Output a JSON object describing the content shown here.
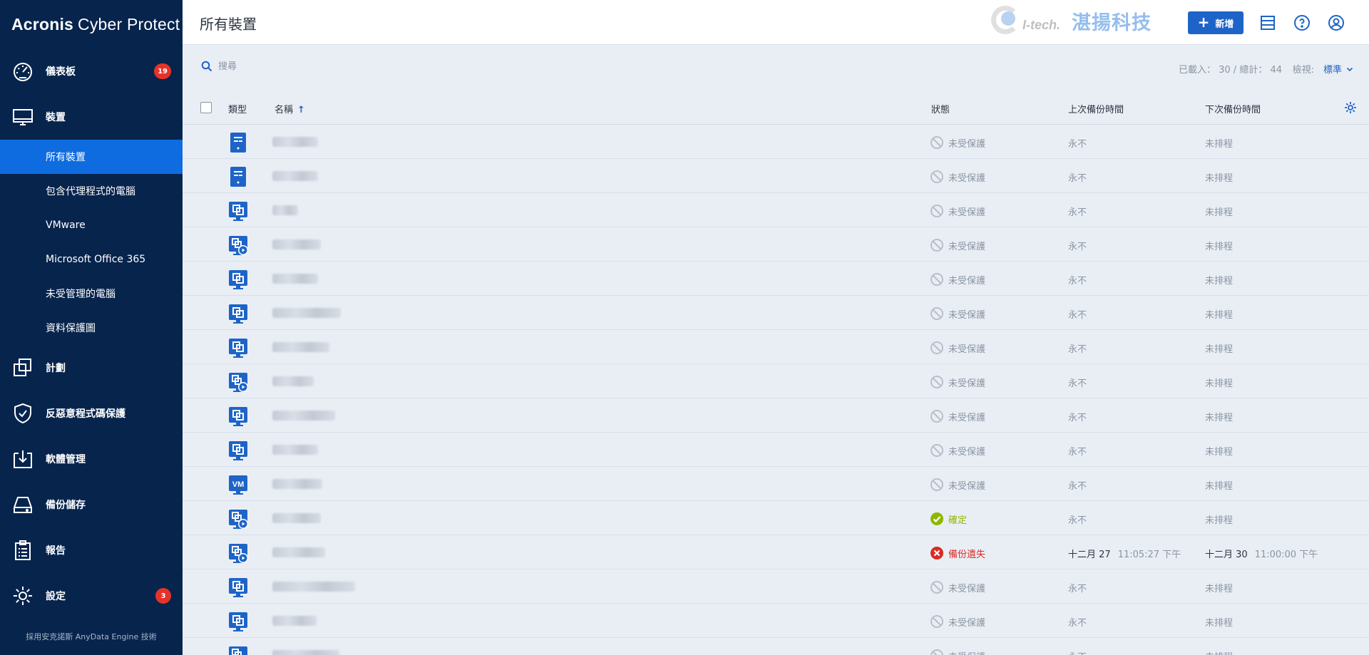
{
  "brand": {
    "part1": "Acronis",
    "part2": "Cyber Protect"
  },
  "sidebar": {
    "items": [
      {
        "label": "儀表板",
        "icon": "dashboard-icon",
        "badge": "19"
      },
      {
        "label": "裝置",
        "icon": "monitor-icon"
      },
      {
        "label": "計劃",
        "icon": "plans-icon"
      },
      {
        "label": "反惡意程式碼保護",
        "icon": "shield-icon"
      },
      {
        "label": "軟體管理",
        "icon": "software-management-icon"
      },
      {
        "label": "備份儲存",
        "icon": "storage-icon"
      },
      {
        "label": "報告",
        "icon": "report-icon"
      },
      {
        "label": "設定",
        "icon": "gear-icon",
        "badge": "3"
      }
    ],
    "sub_items": [
      {
        "label": "所有裝置",
        "active": true
      },
      {
        "label": "包含代理程式的電腦"
      },
      {
        "label": "VMware"
      },
      {
        "label": "Microsoft Office 365"
      },
      {
        "label": "未受管理的電腦"
      },
      {
        "label": "資料保護圖"
      }
    ],
    "footer": "採用安克諾斯 AnyData Engine 技術"
  },
  "header": {
    "title": "所有裝置",
    "watermark_en": "I-tech.",
    "watermark_zh": "湛揚科技",
    "add_label": "新增",
    "accent": "#1e64c8"
  },
  "toolbar": {
    "search_placeholder": "搜尋",
    "counts": "已載入： 30 / 總計： 44",
    "view_label": "檢視:",
    "view_value": "標準"
  },
  "table": {
    "columns": {
      "type": "類型",
      "name": "名稱",
      "status": "狀態",
      "last_backup": "上次備份時間",
      "next_backup": "下次備份時間"
    },
    "rows": [
      {
        "type": "server",
        "status": "未受保護",
        "state": "unprotected",
        "last": "永不",
        "next": "未排程"
      },
      {
        "type": "server",
        "status": "未受保護",
        "state": "unprotected",
        "last": "永不",
        "next": "未排程"
      },
      {
        "type": "workstation",
        "status": "未受保護",
        "state": "unprotected",
        "last": "永不",
        "next": "未排程"
      },
      {
        "type": "workstation-agent",
        "status": "未受保護",
        "state": "unprotected",
        "last": "永不",
        "next": "未排程"
      },
      {
        "type": "workstation",
        "status": "未受保護",
        "state": "unprotected",
        "last": "永不",
        "next": "未排程"
      },
      {
        "type": "workstation",
        "status": "未受保護",
        "state": "unprotected",
        "last": "永不",
        "next": "未排程"
      },
      {
        "type": "workstation",
        "status": "未受保護",
        "state": "unprotected",
        "last": "永不",
        "next": "未排程"
      },
      {
        "type": "workstation-agent",
        "status": "未受保護",
        "state": "unprotected",
        "last": "永不",
        "next": "未排程"
      },
      {
        "type": "workstation",
        "status": "未受保護",
        "state": "unprotected",
        "last": "永不",
        "next": "未排程"
      },
      {
        "type": "workstation",
        "status": "未受保護",
        "state": "unprotected",
        "last": "永不",
        "next": "未排程"
      },
      {
        "type": "vm",
        "vm_label": "VM",
        "status": "未受保護",
        "state": "unprotected",
        "last": "永不",
        "next": "未排程"
      },
      {
        "type": "workstation-agent",
        "status": "確定",
        "state": "ok",
        "last": "永不",
        "next": "未排程"
      },
      {
        "type": "workstation-agent",
        "status": "備份遺失",
        "state": "error",
        "last_date": "十二月 27",
        "last_time": "11:05:27 下午",
        "next_date": "十二月 30",
        "next_time": "11:00:00 下午"
      },
      {
        "type": "workstation",
        "status": "未受保護",
        "state": "unprotected",
        "last": "永不",
        "next": "未排程"
      },
      {
        "type": "workstation",
        "status": "未受保護",
        "state": "unprotected",
        "last": "永不",
        "next": "未排程"
      },
      {
        "type": "workstation-agent",
        "status": "未受保護",
        "state": "unprotected",
        "last": "永不",
        "next": "未排程"
      }
    ]
  }
}
